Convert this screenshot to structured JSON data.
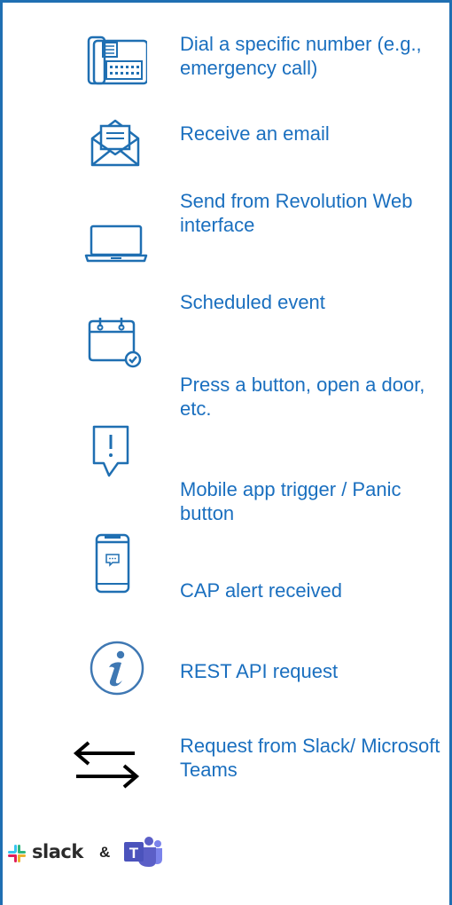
{
  "triggers": [
    {
      "icon": "desk-phone-icon",
      "label": "Dial a specific number (e.g., emergency call)"
    },
    {
      "icon": "email-envelope-icon",
      "label": "Receive an email"
    },
    {
      "icon": "laptop-icon",
      "label": "Send from Revolution Web interface"
    },
    {
      "icon": "calendar-check-icon",
      "label": "Scheduled event"
    },
    {
      "icon": "alert-bubble-icon",
      "label": "Press a button, open a door, etc."
    },
    {
      "icon": "mobile-phone-icon",
      "label": "Mobile app trigger / Panic button"
    },
    {
      "icon": "cap-info-icon",
      "label": "CAP alert received"
    },
    {
      "icon": "exchange-arrows-icon",
      "label": "REST API request"
    },
    {
      "icon": "slack-teams-icon",
      "label": "Request from Slack/ Microsoft Teams"
    }
  ],
  "footer": {
    "slack_logo_text": "slack",
    "ampersand": "&",
    "teams_logo_letter": "T"
  },
  "colors": {
    "text": "#1a6fbf",
    "icon": "#1f6fb2",
    "border": "#1f6fb2"
  }
}
